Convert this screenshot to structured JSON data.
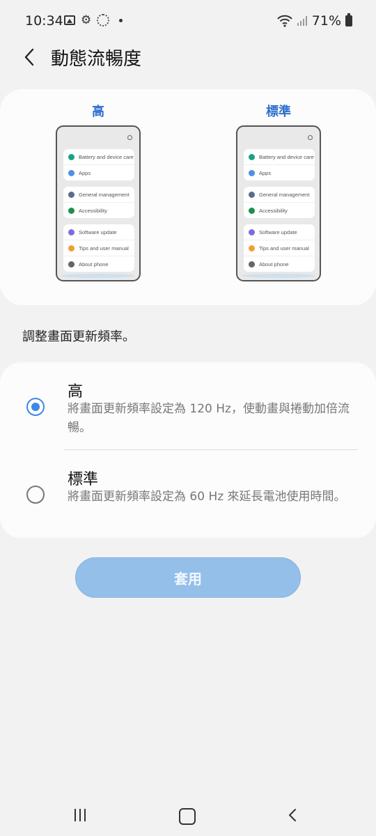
{
  "status_bar": {
    "time": "10:34",
    "battery": "71%"
  },
  "header": {
    "title": "動態流暢度"
  },
  "preview": {
    "left_label": "高",
    "right_label": "標準",
    "phone_items": [
      [
        "Battery and device care",
        "Apps"
      ],
      [
        "General management",
        "Accessibility"
      ],
      [
        "Software update",
        "Tips and user manual",
        "About phone"
      ]
    ]
  },
  "description": "調整畫面更新頻率。",
  "options": [
    {
      "title": "高",
      "subtitle": "將畫面更新頻率設定為 120 Hz，使動畫與捲動加倍流暢。",
      "selected": true
    },
    {
      "title": "標準",
      "subtitle": "將畫面更新頻率設定為 60 Hz 來延長電池使用時間。",
      "selected": false
    }
  ],
  "apply_button": "套用",
  "colors": {
    "accent": "#3e87e6",
    "label_blue": "#2f6fcf",
    "apply_bg": "#94bfe9",
    "icon_colors": [
      "#1aa08b",
      "#4f8fe8",
      "#5a6d8c",
      "#1f8f4f",
      "#7b6fe0",
      "#f0a030",
      "#666666"
    ]
  }
}
